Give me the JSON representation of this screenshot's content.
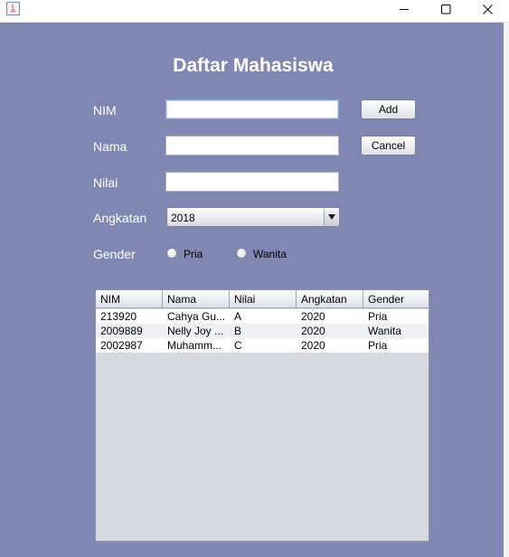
{
  "window": {
    "controls": {
      "minimize": "minimize-icon",
      "maximize": "maximize-icon",
      "close": "close-icon"
    }
  },
  "form": {
    "title": "Daftar Mahasiswa",
    "fields": {
      "nim": {
        "label": "NIM",
        "value": ""
      },
      "nama": {
        "label": "Nama",
        "value": ""
      },
      "nilai": {
        "label": "Nilai",
        "value": ""
      }
    },
    "angkatan": {
      "label": "Angkatan",
      "selected": "2018"
    },
    "gender": {
      "label": "Gender",
      "options": [
        "Pria",
        "Wanita"
      ],
      "selected": null
    },
    "buttons": {
      "add": "Add",
      "cancel": "Cancel"
    }
  },
  "table": {
    "columns": [
      "NIM",
      "Nama",
      "Nilai",
      "Angkatan",
      "Gender"
    ],
    "rows": [
      {
        "nim": "213920",
        "nama": "Cahya Gu...",
        "nilai": "A",
        "angkatan": "2020",
        "gender": "Pria"
      },
      {
        "nim": "2009889",
        "nama": "Nelly Joy ...",
        "nilai": "B",
        "angkatan": "2020",
        "gender": "Wanita"
      },
      {
        "nim": "2002987",
        "nama": "Muhamm...",
        "nilai": "C",
        "angkatan": "2020",
        "gender": "Pria"
      }
    ]
  },
  "colors": {
    "background": "#8087b3",
    "table_empty": "#d6d9e0",
    "row_alt": "#eef0f4"
  }
}
